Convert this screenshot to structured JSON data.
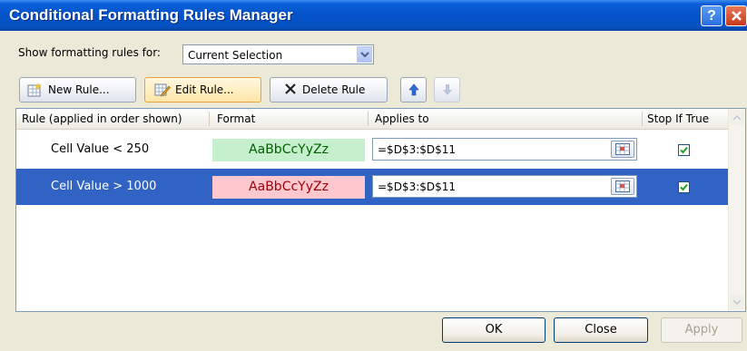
{
  "window": {
    "title": "Conditional Formatting Rules Manager",
    "help_glyph": "?"
  },
  "filter": {
    "label": "Show formatting rules for:",
    "value": "Current Selection"
  },
  "toolbar": {
    "new_rule": "New Rule...",
    "edit_rule": "Edit Rule...",
    "delete_rule": "Delete Rule"
  },
  "table": {
    "columns": [
      "Rule (applied in order shown)",
      "Format",
      "Applies to",
      "Stop If True"
    ],
    "rows": [
      {
        "rule": "Cell Value < 250",
        "format_preview": "AaBbCcYyZz",
        "applies_to": "=$D$3:$D$11",
        "stop_if_true": true,
        "selected": false
      },
      {
        "rule": "Cell Value > 1000",
        "format_preview": "AaBbCcYyZz",
        "applies_to": "=$D$3:$D$11",
        "stop_if_true": true,
        "selected": true
      }
    ]
  },
  "footer": {
    "ok": "OK",
    "close": "Close",
    "apply": "Apply"
  },
  "colors": {
    "selection": "#3163c5",
    "good_fill": "#c6efce",
    "good_text": "#006100",
    "bad_fill": "#ffc7ce",
    "bad_text": "#9c0006"
  }
}
